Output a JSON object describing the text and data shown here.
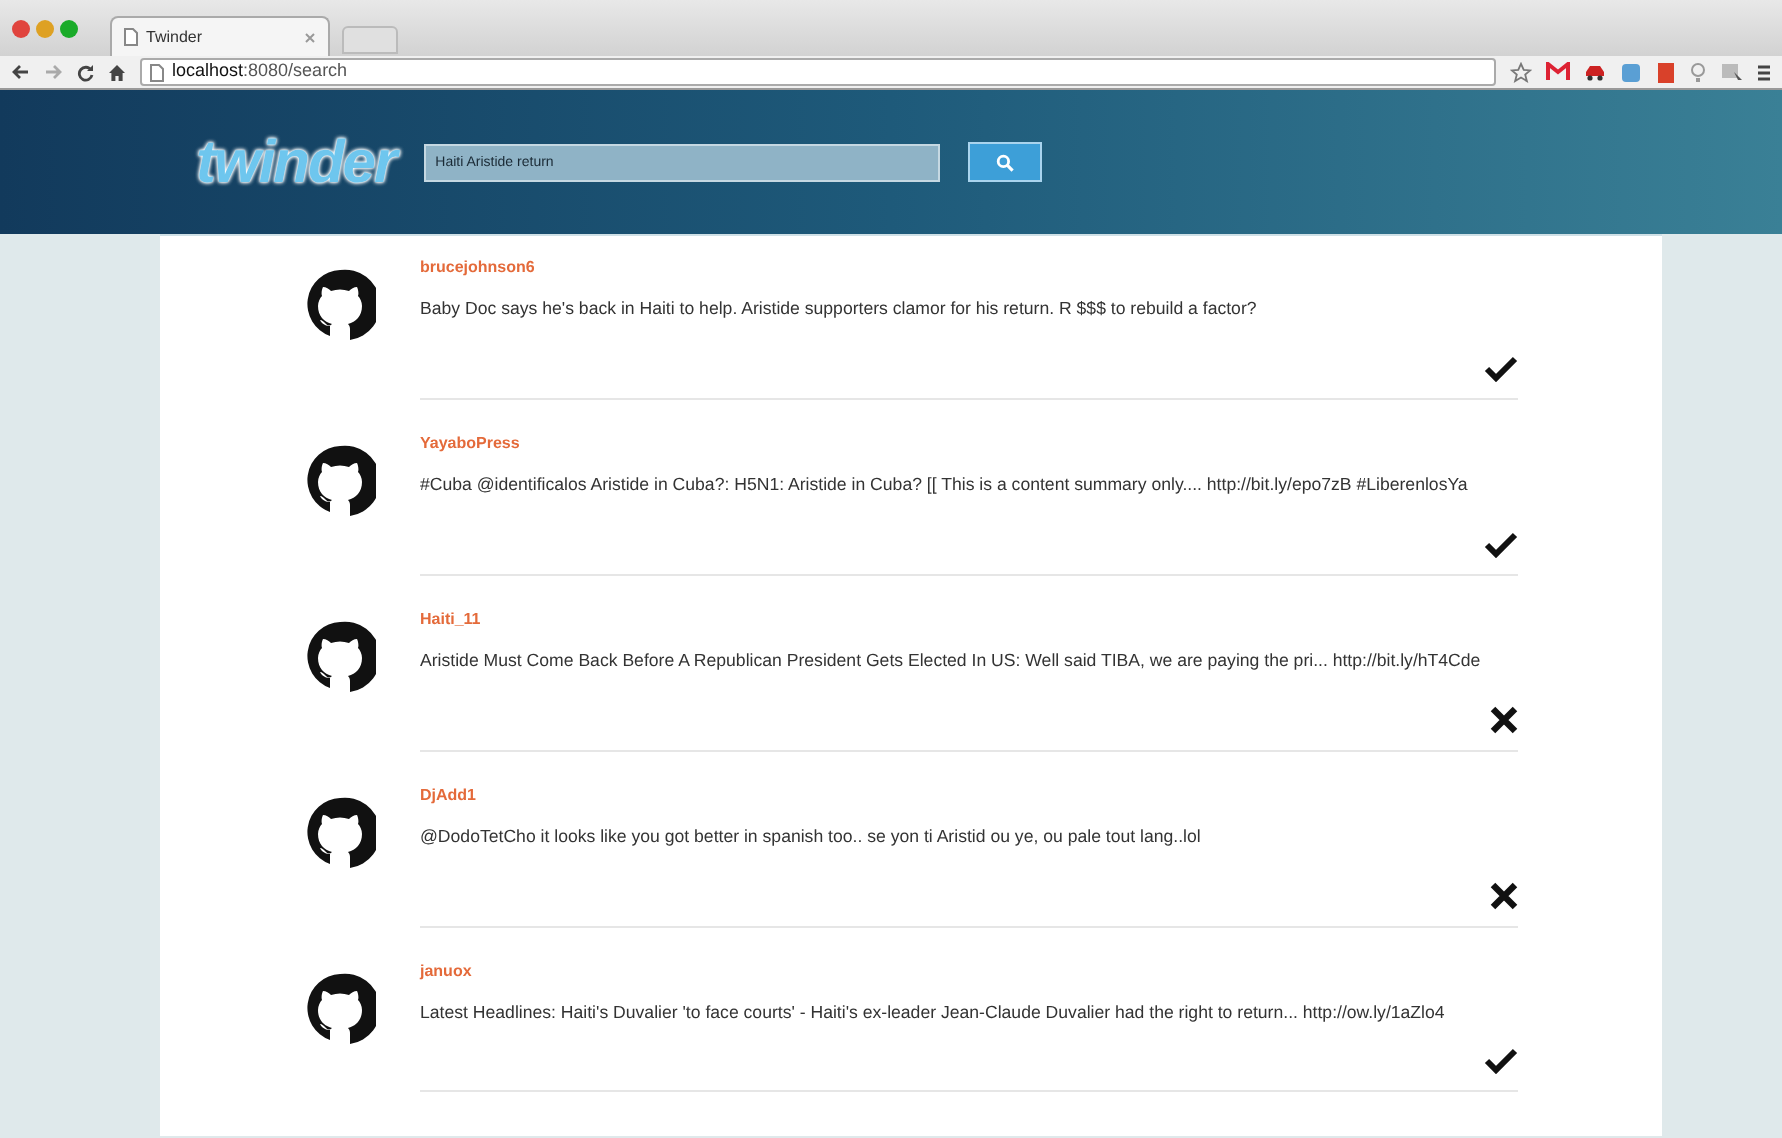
{
  "browser": {
    "tab_title": "Twinder",
    "url_host": "localhost",
    "url_rest": ":8080/search"
  },
  "header": {
    "logo": "twinder",
    "search": {
      "value": "Haiti Aristide return"
    }
  },
  "tweets": [
    {
      "user": "brucejohnson6",
      "text": "Baby Doc says he's back in Haiti to help. Aristide supporters clamor for his return. R $$$ to rebuild a factor?",
      "approved": true
    },
    {
      "user": "YayaboPress",
      "text": "#Cuba @identificalos Aristide in Cuba?: H5N1: Aristide in Cuba? [[ This is a content summary only.... http://bit.ly/epo7zB #LiberenlosYa",
      "approved": true
    },
    {
      "user": "Haiti_11",
      "text": "Aristide Must Come Back Before A Republican President Gets Elected In US: Well said TIBA, we are paying the pri... http://bit.ly/hT4Cde",
      "approved": false
    },
    {
      "user": "DjAdd1",
      "text": "@DodoTetCho it looks like you got better in spanish too.. se yon ti Aristid ou ye, ou pale tout lang..lol",
      "approved": false
    },
    {
      "user": "januox",
      "text": "Latest Headlines: Haiti's Duvalier 'to face courts' - Haiti's ex-leader Jean-Claude Duvalier had the right to return... http://ow.ly/1aZlo4",
      "approved": true
    }
  ]
}
